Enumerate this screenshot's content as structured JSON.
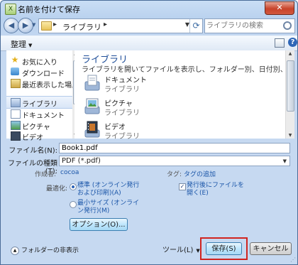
{
  "window": {
    "title": "名前を付けて保存",
    "close_label": "✕"
  },
  "nav": {
    "back": "◀",
    "forward": "▶",
    "address_path": "ライブラリ",
    "search_placeholder": "ライブラリの検索"
  },
  "toolbar": {
    "organize_label": "整理"
  },
  "sidebar": {
    "items": [
      {
        "label": "お気に入り"
      },
      {
        "label": "ダウンロード"
      },
      {
        "label": "最近表示した場所"
      },
      {
        "label": "ライブラリ"
      },
      {
        "label": "ドキュメント"
      },
      {
        "label": "ピクチャ"
      },
      {
        "label": "ビデオ"
      }
    ]
  },
  "library": {
    "title": "ライブラリ",
    "description": "ライブラリを開いてファイルを表示し、フォルダー別、日付別、またはその他の基...",
    "items": [
      {
        "name": "ドキュメント",
        "type": "ライブラリ"
      },
      {
        "name": "ピクチャ",
        "type": "ライブラリ"
      },
      {
        "name": "ビデオ",
        "type": "ライブラリ"
      }
    ]
  },
  "form": {
    "filename_label": "ファイル名(N):",
    "filename_value": "Book1.pdf",
    "filetype_label": "ファイルの種類(T):",
    "filetype_value": "PDF (*.pdf)",
    "author_label": "作成者:",
    "author_value": "cocoa",
    "tags_label": "タグ:",
    "tags_value": "タグの追加",
    "optimize_label": "最適化:",
    "opt_standard_line1": "標準 (オンライン発行",
    "opt_standard_line2": "および印刷)(A)",
    "opt_min_line1": "最小サイズ (オンライ",
    "opt_min_line2": "ン発行)(M)",
    "open_after_line1": "発行後にファイルを",
    "open_after_line2": "開く(E)",
    "options_button": "オプション(O)...",
    "hide_folders": "フォルダーの非表示",
    "tools_label": "ツール(L)",
    "save_button": "保存(S)",
    "cancel_button": "キャンセル"
  },
  "colors": {
    "highlight": "#d0241f",
    "link": "#1a55a8",
    "title_blue": "#1f4e99"
  }
}
